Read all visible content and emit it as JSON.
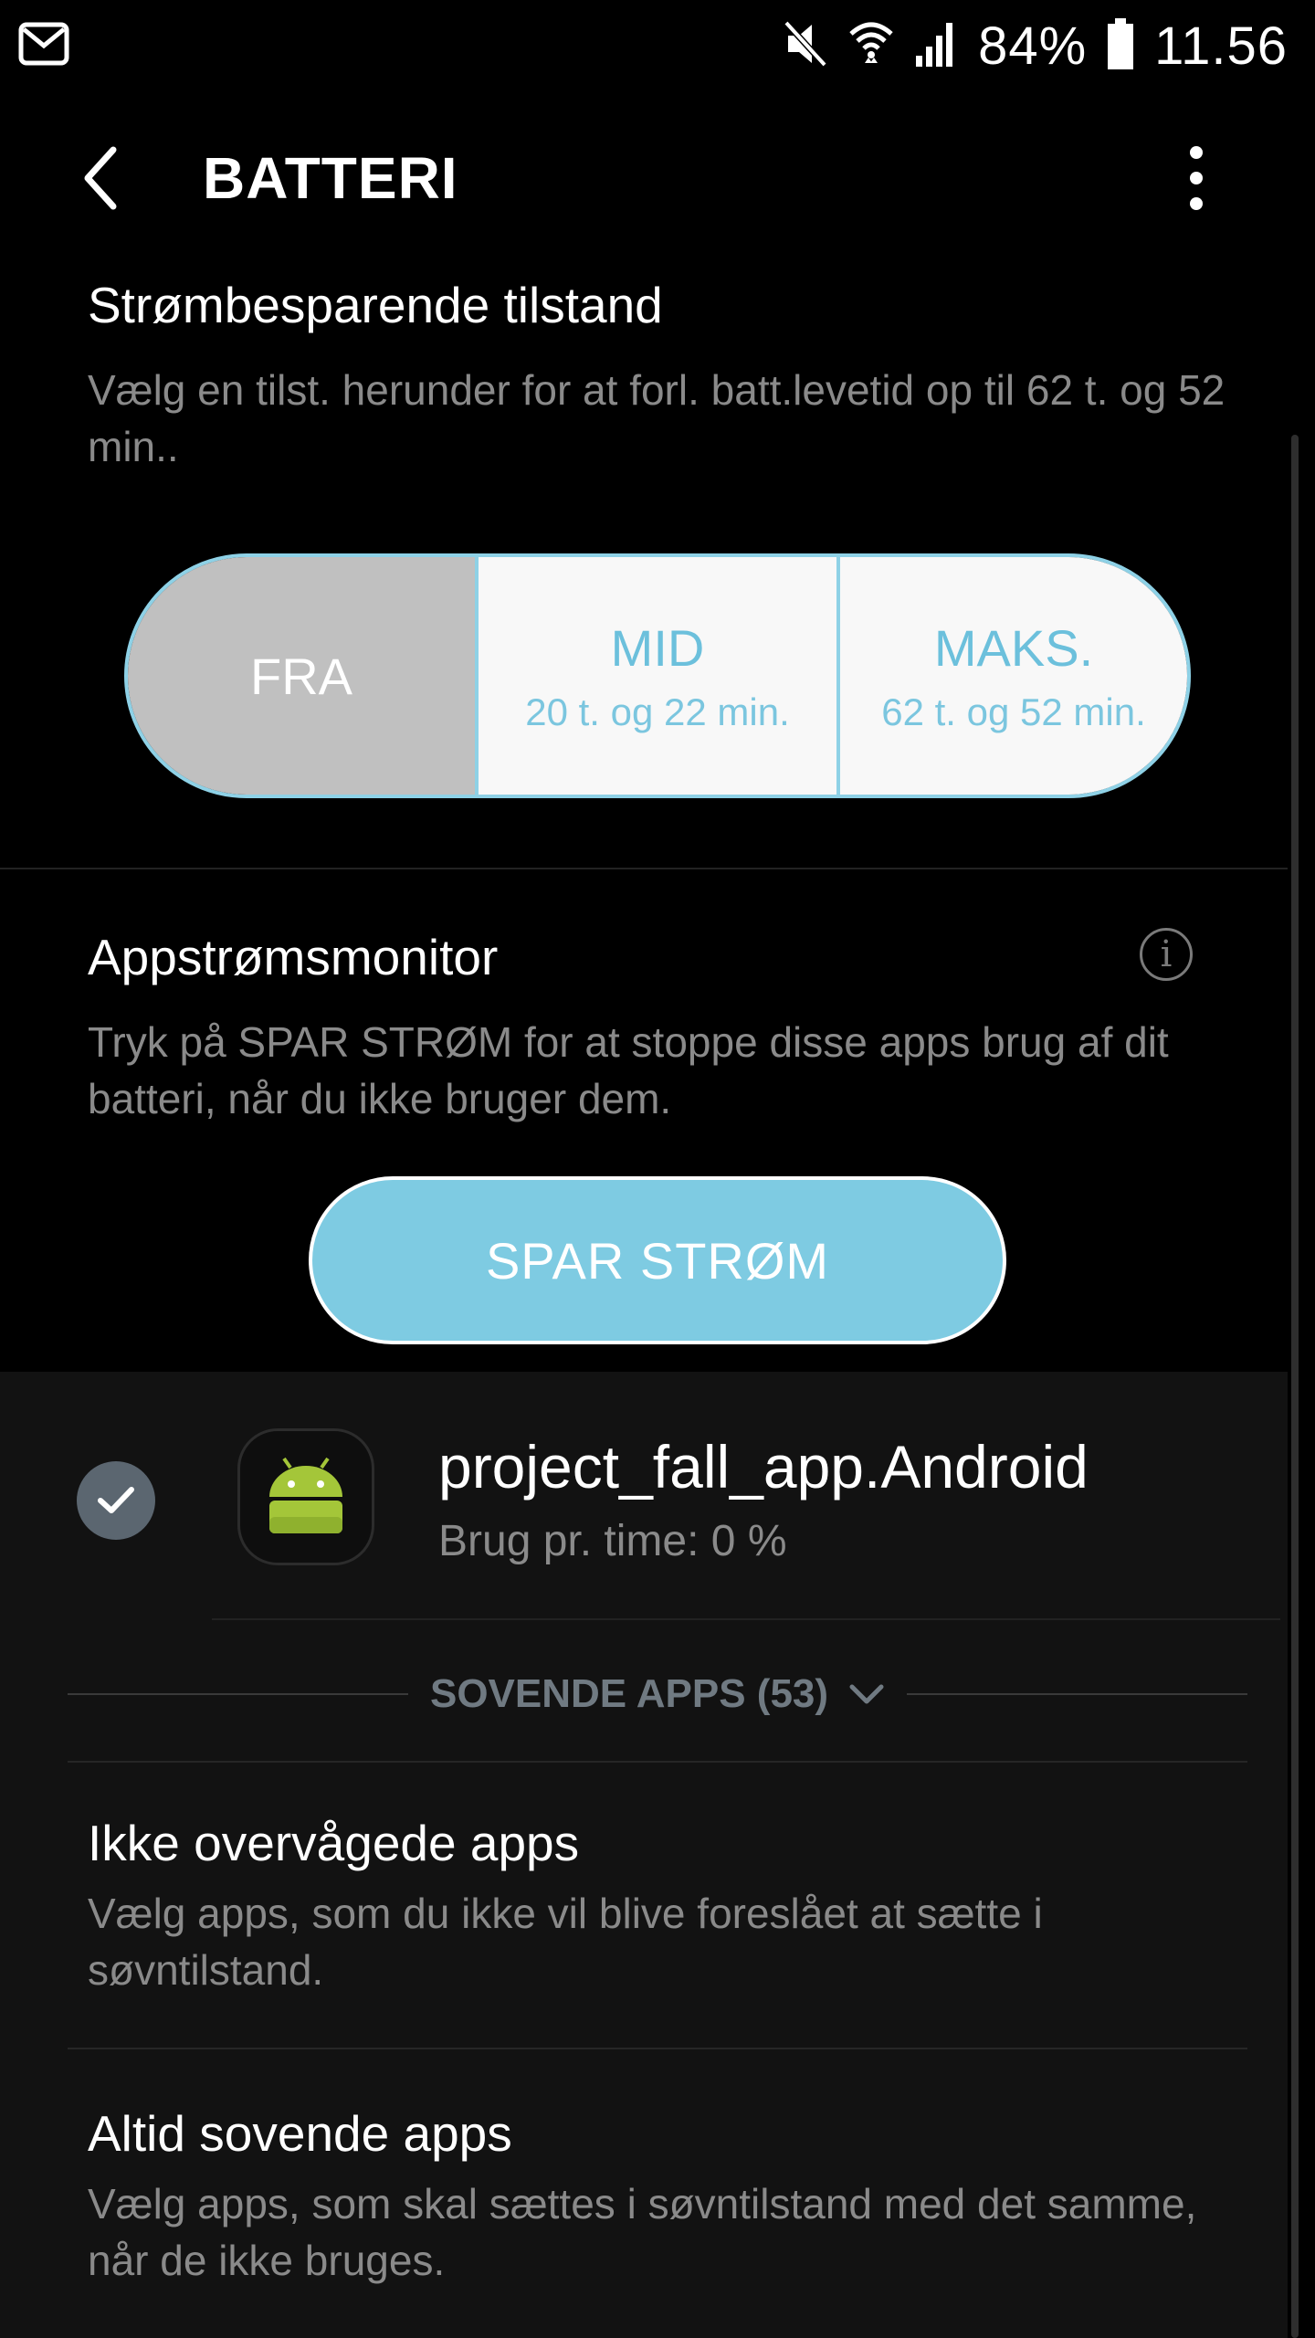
{
  "status_bar": {
    "battery_percent": "84%",
    "time": "11.56",
    "icons": [
      "mail-icon",
      "mute-icon",
      "wifi-icon",
      "signal-icon",
      "battery-icon"
    ]
  },
  "app_bar": {
    "title": "BATTERI"
  },
  "power_saving": {
    "heading": "Strømbesparende tilstand",
    "description": "Vælg en tilst. herunder for at forl. batt.levetid op til 62 t. og 52 min..",
    "modes": [
      {
        "label": "FRA",
        "sub": ""
      },
      {
        "label": "MID",
        "sub": "20 t. og 22 min."
      },
      {
        "label": "MAKS.",
        "sub": "62 t. og 52 min."
      }
    ],
    "selected": "FRA"
  },
  "app_monitor": {
    "heading": "Appstrømsmonitor",
    "description": "Tryk på SPAR STRØM for at stoppe disse apps brug af dit batteri, når du ikke bruger dem.",
    "save_button": "SPAR STRØM"
  },
  "app_list": [
    {
      "name": "project_fall_app.Android",
      "usage": "Brug pr. time: 0 %",
      "checked": true
    }
  ],
  "sleeping_apps": {
    "label": "SOVENDE APPS (53)"
  },
  "settings": [
    {
      "title": "Ikke overvågede apps",
      "description": "Vælg apps, som du ikke vil blive foreslået at sætte i søvntilstand."
    },
    {
      "title": "Altid sovende apps",
      "description": "Vælg apps, som skal sættes i søvntilstand med det samme, når de ikke bruges."
    }
  ],
  "colors": {
    "accent": "#7ecbe2",
    "segment_border": "#8ed1e6",
    "off_segment": "#c0c0c0"
  }
}
